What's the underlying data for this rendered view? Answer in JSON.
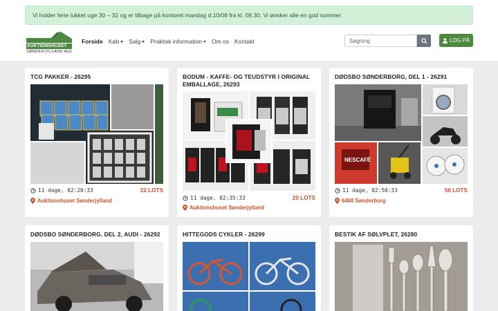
{
  "alert": {
    "text": "Vi holder ferie lukket uge 30 – 32 og er tilbage på kontoret mandag d.10/08 fra kl. 08.30. Vi ønsker alle en god sommer"
  },
  "logo": {
    "brand": "AUKTIONSHUSET",
    "sub": "SØNDERJYLLAND ApS"
  },
  "nav": {
    "items": [
      "Forside",
      "Køb",
      "Salg",
      "Praktisk information",
      "Om os",
      "Kontakt"
    ]
  },
  "search": {
    "placeholder": "Søgning"
  },
  "login": {
    "label": "LOG PÅ"
  },
  "colors": {
    "green": "#4b8a3e",
    "lots": "#d0512c"
  },
  "cards": [
    {
      "title": "TCG PAKKER - 26295",
      "time": "11 dage, 02:20:33",
      "lots": "22 LOTS",
      "location": "Auktionshuset Sønderjylland"
    },
    {
      "title": "BODUM - KAFFE- OG TEUDSTYR I ORIGINAL EMBALLAGE, 26293",
      "time": "11 dage, 02:35:33",
      "lots": "20 LOTS",
      "location": "Auktionshuset Sønderjylland"
    },
    {
      "title": "DØDSBO SØNDERBORG, DEL 1 - 26291",
      "time": "11 dage, 02:50:33",
      "lots": "56 LOTS",
      "location": "6400 Sønderborg"
    },
    {
      "title": "DØDSBO SØNDERBORG, DEL 2, AUDI - 26292"
    },
    {
      "title": "HITTEGODS CYKLER - 26299"
    },
    {
      "title": "BESTIK AF SØLVPLET, 26280"
    }
  ]
}
